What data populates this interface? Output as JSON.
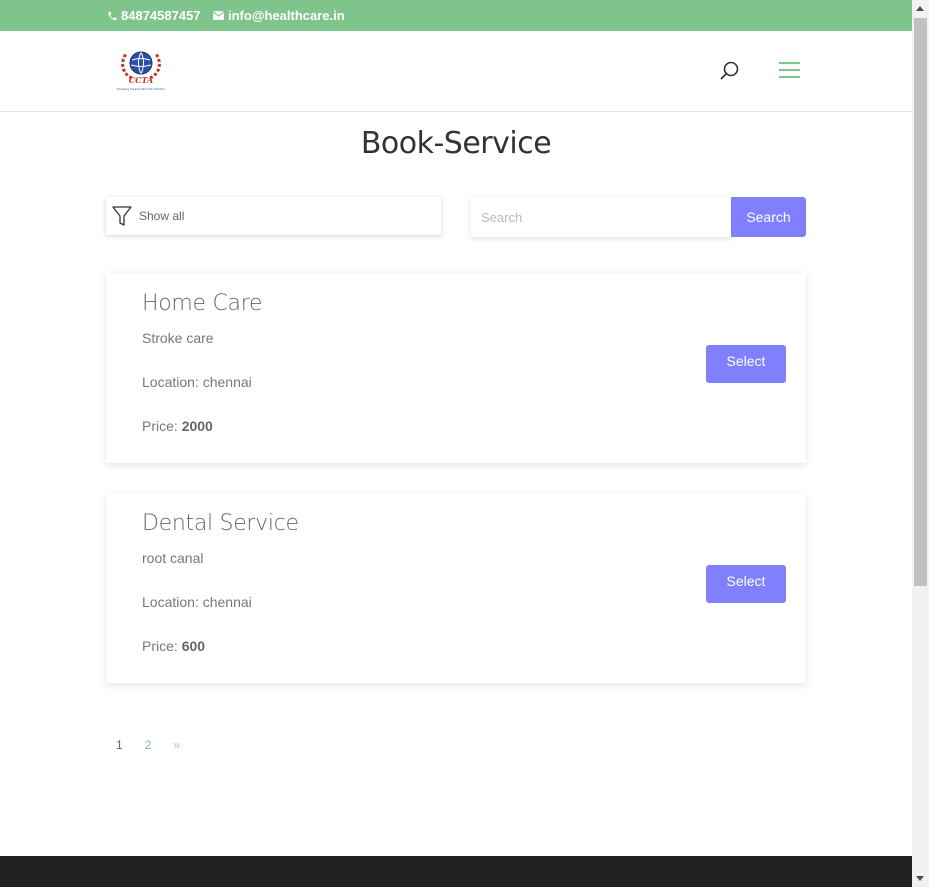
{
  "topbar": {
    "phone": "84874587457",
    "email": "info@healthcare.in",
    "phone_icon": "phone-icon",
    "email_icon": "envelope-icon",
    "bg_color": "#7fc48a"
  },
  "header": {
    "logo_text": "CCTA",
    "logo_tagline": "Changing Towards World Of Addiction",
    "search_icon": "search-icon",
    "menu_icon": "hamburger-menu-icon"
  },
  "page": {
    "title": "Book-Service"
  },
  "filter": {
    "label": "Show all",
    "icon": "funnel-icon"
  },
  "search": {
    "placeholder": "Search",
    "button_label": "Search"
  },
  "services": [
    {
      "name": "Home Care",
      "description": "Stroke care",
      "location_label": "Location: chennai",
      "price_label": "Price: ",
      "price_value": "2000",
      "select_label": "Select"
    },
    {
      "name": "Dental Service",
      "description": "root canal",
      "location_label": "Location: chennai",
      "price_label": "Price: ",
      "price_value": "600",
      "select_label": "Select"
    }
  ],
  "pagination": {
    "current": "1",
    "page2": "2",
    "next": "»"
  },
  "colors": {
    "accent": "#8080ff",
    "green": "#7fc48a",
    "footer": "#222222"
  }
}
